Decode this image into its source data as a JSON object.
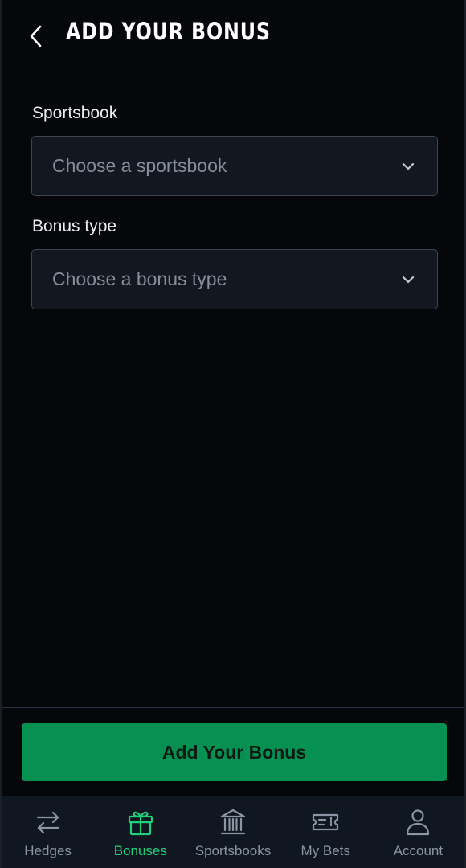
{
  "header": {
    "title": "ADD YOUR BONUS",
    "back_icon": "chevron-left-icon"
  },
  "form": {
    "sportsbook": {
      "label": "Sportsbook",
      "placeholder": "Choose a sportsbook"
    },
    "bonus_type": {
      "label": "Bonus type",
      "placeholder": "Choose a bonus type"
    }
  },
  "actions": {
    "submit_label": "Add Your Bonus"
  },
  "nav": {
    "items": [
      {
        "label": "Hedges",
        "icon": "swap-arrows-icon",
        "active": false
      },
      {
        "label": "Bonuses",
        "icon": "gift-icon",
        "active": true
      },
      {
        "label": "Sportsbooks",
        "icon": "bank-icon",
        "active": false
      },
      {
        "label": "My Bets",
        "icon": "ticket-icon",
        "active": false
      },
      {
        "label": "Account",
        "icon": "user-icon",
        "active": false
      }
    ]
  },
  "colors": {
    "accent": "#1fd07d",
    "button": "#069153",
    "background": "#05070a",
    "field_bg": "#131820",
    "muted": "#8b95a3"
  }
}
